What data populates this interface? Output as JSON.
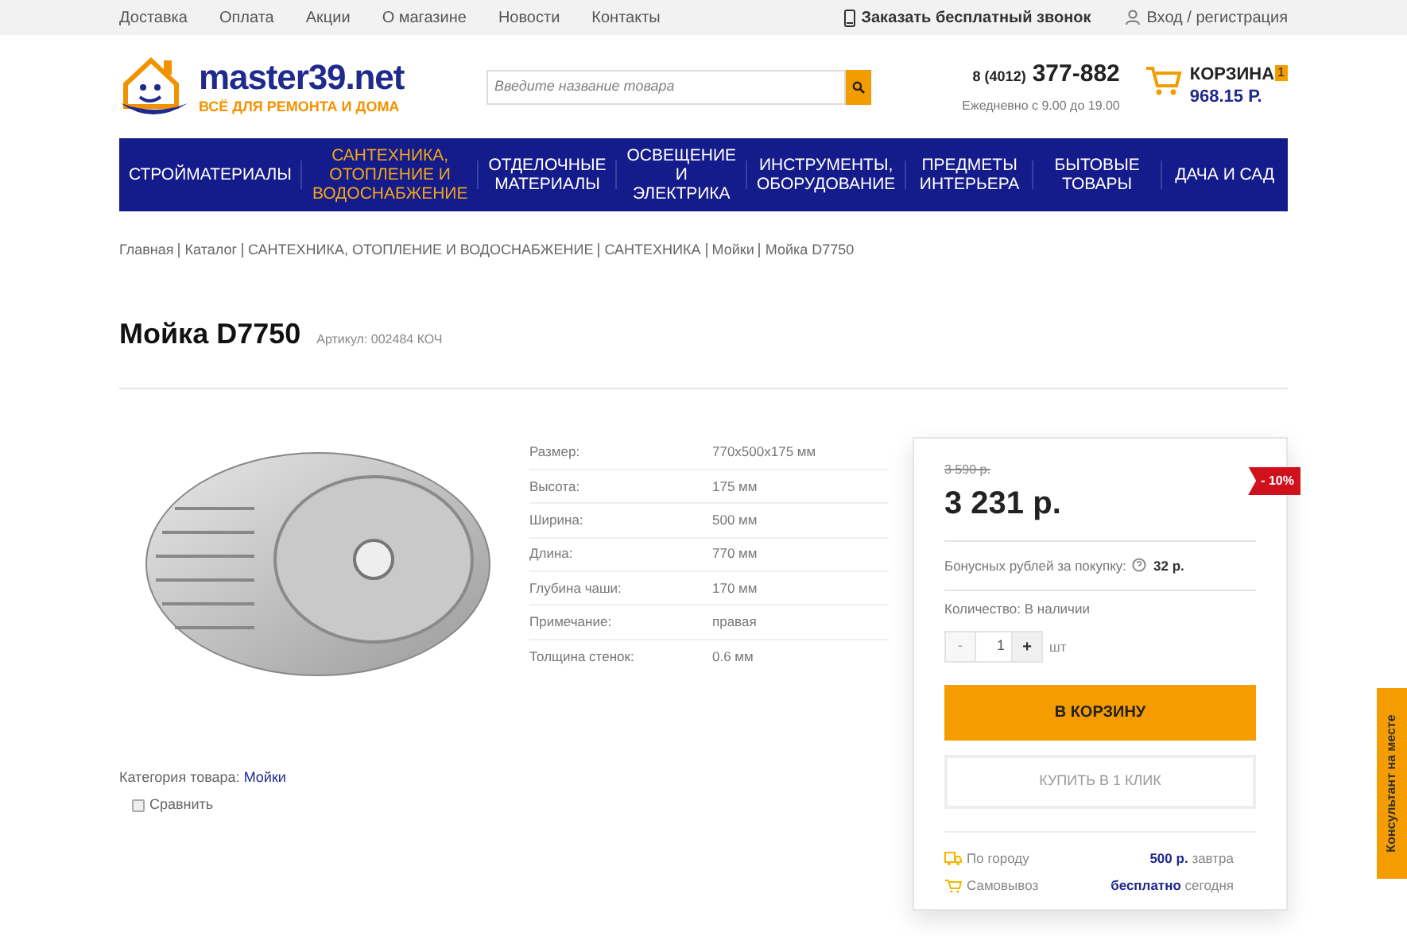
{
  "top_links": [
    "Доставка",
    "Оплата",
    "Акции",
    "О магазине",
    "Новости",
    "Контакты"
  ],
  "callback": "Заказать бесплатный звонок",
  "login": "Вход / регистрация",
  "logo": {
    "name": "master39.net",
    "slogan": "ВСЁ ДЛЯ РЕМОНТА И ДОМА"
  },
  "search": {
    "placeholder": "Введите название товара"
  },
  "phone": {
    "code": "8 (4012)",
    "number": "377-882",
    "hours": "Ежедневно с 9.00 до 19.00"
  },
  "cart": {
    "label": "КОРЗИНА",
    "count": "1",
    "total": "968.15 Р."
  },
  "nav": [
    {
      "label": "СТРОЙМАТЕРИАЛЫ",
      "selected": false
    },
    {
      "label": "САНТЕХНИКА, ОТОПЛЕНИЕ И ВОДОСНАБЖЕНИЕ",
      "selected": true
    },
    {
      "label": "ОТДЕЛОЧНЫЕ МАТЕРИАЛЫ",
      "selected": false
    },
    {
      "label": "ОСВЕЩЕНИЕ И ЭЛЕКТРИКА",
      "selected": false
    },
    {
      "label": "ИНСТРУМЕНТЫ, ОБОРУДОВАНИЕ",
      "selected": false
    },
    {
      "label": "ПРЕДМЕТЫ ИНТЕРЬЕРА",
      "selected": false
    },
    {
      "label": "БЫТОВЫЕ ТОВАРЫ",
      "selected": false
    },
    {
      "label": "ДАЧА И САД",
      "selected": false
    }
  ],
  "breadcrumbs": [
    "Главная",
    "Каталог",
    "САНТЕХНИКА, ОТОПЛЕНИЕ И ВОДОСНАБЖЕНИЕ",
    "САНТЕХНИКА",
    "Мойки",
    "Мойка D7750"
  ],
  "product": {
    "title": "Мойка D7750",
    "sku": "Артикул: 002484 КОЧ",
    "category_label": "Категория товара:",
    "category": "Мойки",
    "compare": {
      "label": "Сравнить",
      "checked": false
    }
  },
  "specs": [
    {
      "name": "Размер:",
      "value": "770x500x175 мм"
    },
    {
      "name": "Высота:",
      "value": "175 мм"
    },
    {
      "name": "Ширина:",
      "value": "500 мм"
    },
    {
      "name": "Длина:",
      "value": "770 мм"
    },
    {
      "name": "Глубина чаши:",
      "value": "170 мм"
    },
    {
      "name": "Примечание:",
      "value": "правая"
    },
    {
      "name": "Толщина стенок:",
      "value": "0.6 мм"
    }
  ],
  "buy": {
    "old_price": "3 590 р.",
    "price": "3 231 р.",
    "discount": "- 10%",
    "bonus_label": "Бонусных рублей за покупку:",
    "bonus": "32 р.",
    "stock": "Количество: В наличии",
    "minus": "-",
    "qty": "1",
    "plus": "+",
    "unit": "шт",
    "add_button": "В КОРЗИНУ",
    "one_click": "КУПИТЬ В 1 КЛИК",
    "delivery": [
      {
        "kind": "truck",
        "label": "По городу",
        "price": "500 р.",
        "when": "завтра"
      },
      {
        "kind": "cart",
        "label": "Самовывоз",
        "price": "бесплатно",
        "when": "сегодня"
      }
    ]
  },
  "consultant": "Консультант на месте"
}
